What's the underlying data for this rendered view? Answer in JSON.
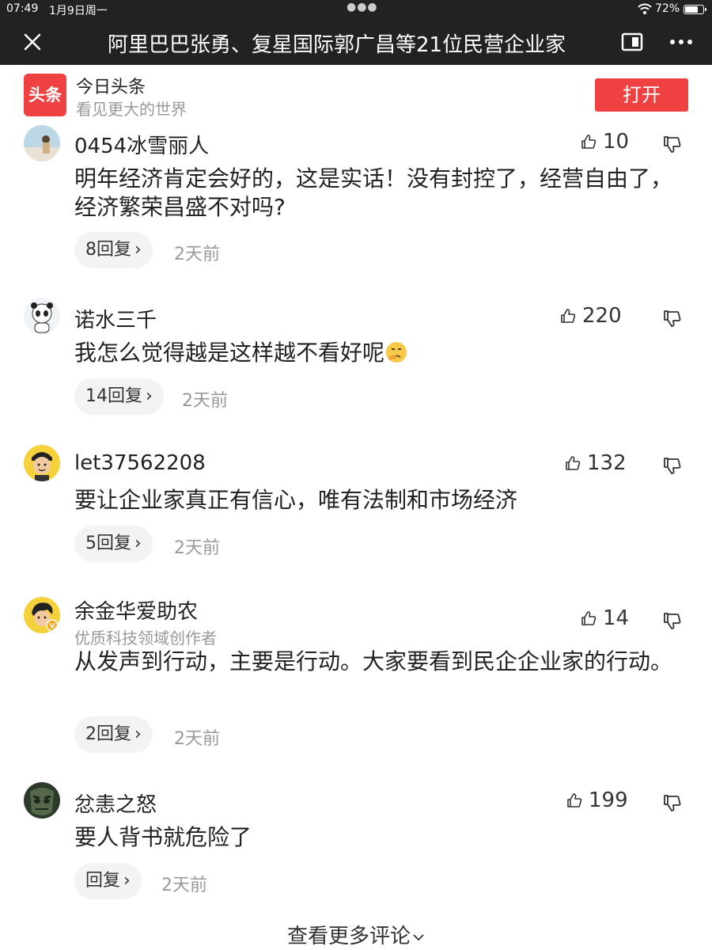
{
  "status_bar": {
    "time": "07:49",
    "date": "1月9日周一",
    "battery": "72%",
    "battery_level": 0.72
  },
  "nav": {
    "title": "阿里巴巴张勇、复星国际郭广昌等21位民营企业家"
  },
  "banner": {
    "app_name": "今日头条",
    "slogan": "看见更大的世界",
    "logo_text": "头条",
    "open_label": "打开"
  },
  "comments": [
    {
      "name": "0454冰雪丽人",
      "likes": "10",
      "text": "明年经济肯定会好的，这是实话！没有封控了，经营自由了，经济繁荣昌盛不对吗?",
      "replies": "8回复",
      "time": "2天前"
    },
    {
      "name": "诺水三千",
      "likes": "220",
      "text": "我怎么觉得越是这样越不看好呢",
      "replies": "14回复",
      "time": "2天前"
    },
    {
      "name": "let37562208",
      "likes": "132",
      "text": "要让企业家真正有信心，唯有法制和市场经济",
      "replies": "5回复",
      "time": "2天前"
    },
    {
      "name": "余金华爱助农",
      "subtitle": "优质科技领域创作者",
      "likes": "14",
      "text": "从发声到行动，主要是行动。大家要看到民企企业家的行动。",
      "replies": "2回复",
      "time": "2天前"
    },
    {
      "name": "忿恚之怒",
      "likes": "199",
      "text": "要人背书就危险了",
      "replies": "回复",
      "time": "2天前"
    }
  ],
  "more_comments": "查看更多评论",
  "colors": {
    "accent": "#f04142",
    "bar": "#222222"
  }
}
